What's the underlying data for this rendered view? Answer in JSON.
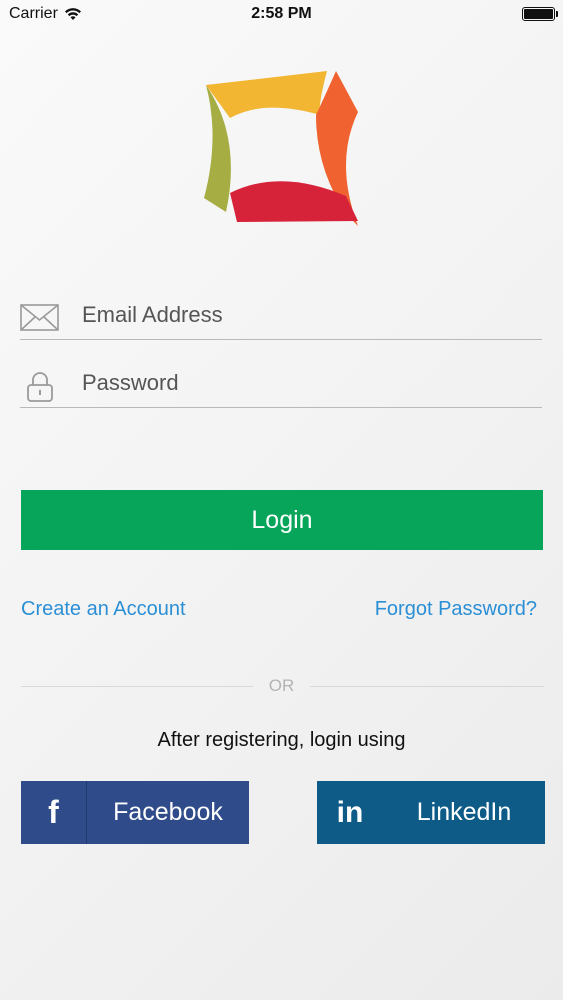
{
  "status_bar": {
    "carrier": "Carrier",
    "time": "2:58 PM"
  },
  "form": {
    "email_placeholder": "Email Address",
    "password_placeholder": "Password",
    "login_label": "Login"
  },
  "links": {
    "create_account": "Create an Account",
    "forgot_password": "Forgot Password?"
  },
  "divider_text": "OR",
  "social": {
    "caption": "After registering, login using",
    "facebook_icon": "f",
    "facebook_label": "Facebook",
    "linkedin_icon": "in",
    "linkedin_label": "LinkedIn"
  },
  "colors": {
    "login_green": "#06a55a",
    "link_blue": "#2b8fd6",
    "facebook_blue": "#2f4b8a",
    "linkedin_blue": "#0e5b87",
    "logo_yellow": "#f2b632",
    "logo_orange": "#f0622f",
    "logo_red": "#d7233a",
    "logo_green": "#a6ad42"
  },
  "icons": [
    "wifi-icon",
    "battery-icon",
    "envelope-icon",
    "lock-icon",
    "facebook-icon",
    "linkedin-icon"
  ]
}
